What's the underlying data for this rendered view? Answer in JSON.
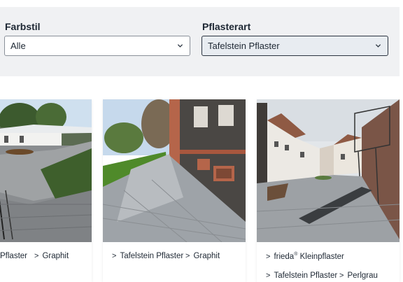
{
  "filters": {
    "color_style": {
      "label": "Farbstil",
      "value": "Alle"
    },
    "paving_type": {
      "label": "Pflasterart",
      "value": "Tafelstein Pflaster"
    }
  },
  "cards": [
    {
      "tags": [
        "Pflaster",
        "Graphit"
      ]
    },
    {
      "tags": [
        "Tafelstein Pflaster",
        "Graphit"
      ]
    },
    {
      "tags_line1": {
        "brand": "frieda",
        "mark": "®",
        "product": "Kleinpflaster"
      },
      "tags_line2": [
        "Tafelstein Pflaster",
        "Perlgrau"
      ]
    }
  ],
  "icons": {
    "tag_arrow": "chevron-right-icon",
    "select_arrow": "chevron-down-icon"
  }
}
